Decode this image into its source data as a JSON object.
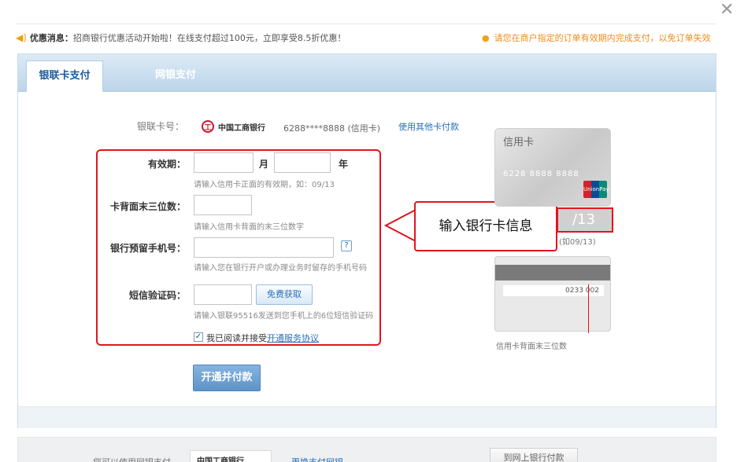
{
  "dialog": {
    "close_symbol": "✕"
  },
  "notice": {
    "label": "优惠消息：",
    "text": "招商银行优惠活动开始啦！在线支付超过100元，立即享受8.5折优惠！",
    "right_text": "请您在商户指定的订单有效期内完成支付，以免订单失效"
  },
  "tabs": [
    {
      "label": "银联卡支付",
      "active": true
    },
    {
      "label": "网银支付",
      "active": false
    }
  ],
  "form": {
    "card_number_label": "银联卡号：",
    "bank_name": "中国工商银行",
    "card_masked": "6288****8888 (信用卡)",
    "other_card_link": "使用其他卡付款",
    "expiry_label": "有效期：",
    "month_unit": "月",
    "year_unit": "年",
    "expiry_hint": "请输入信用卡正面的有效期，如：09/13",
    "cvv_label": "卡背面末三位数：",
    "cvv_hint": "请输入信用卡背面的末三位数字",
    "phone_label": "银行预留手机号：",
    "phone_hint": "请输入您在银行开户或办理业务时留存的手机号码",
    "help_symbol": "?",
    "sms_label": "短信验证码：",
    "sms_button": "免费获取",
    "sms_hint": "请输入银联95516发送到您手机上的6位短信验证码",
    "agree_checked": true,
    "agree_text": "我已阅读并接受",
    "agree_link": "开通服务协议",
    "submit_button": "开通并付款"
  },
  "callout": {
    "text": "输入银行卡信息"
  },
  "card_illustration": {
    "front_title": "信用卡",
    "front_number": "6228 8888 8888",
    "unionpay_label": "UnionPay",
    "expiry_value": "/13",
    "expiry_note": "(如09/13)",
    "back_signature": "0233 002",
    "back_note": "信用卡背面末三位数"
  },
  "footer": {
    "text": "您可以使用网银支付",
    "bank_name": "中国工商银行",
    "link": "更换支付网银",
    "button": "到网上银行付款"
  },
  "colors": {
    "accent_red": "#e3141e",
    "link_blue": "#2a6fb7",
    "notice_orange": "#f08c1a"
  }
}
